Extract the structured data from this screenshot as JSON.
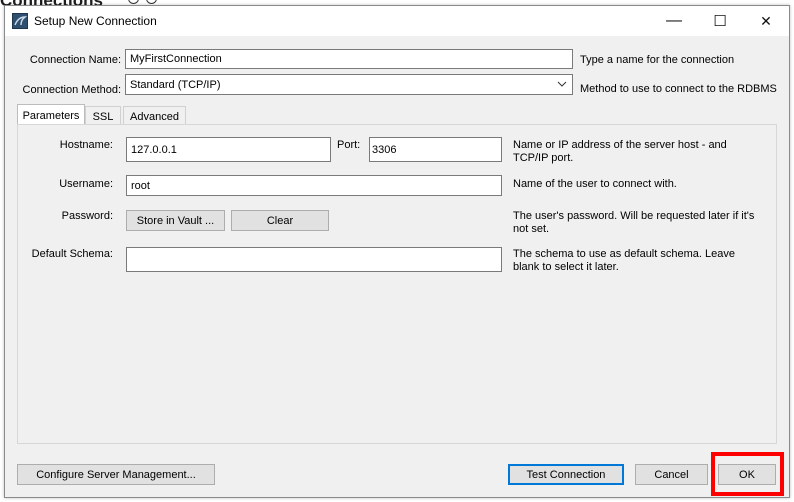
{
  "background": {
    "heading": "Connections"
  },
  "window": {
    "title": "Setup New Connection"
  },
  "controls": {
    "minimize": "—",
    "maximize": "☐",
    "close": "✕"
  },
  "form": {
    "connection_name": {
      "label": "Connection Name:",
      "value": "MyFirstConnection",
      "hint": "Type a name for the connection"
    },
    "connection_method": {
      "label": "Connection Method:",
      "value": "Standard (TCP/IP)",
      "hint": "Method to use to connect to the RDBMS"
    }
  },
  "tabs": [
    {
      "label": "Parameters",
      "active": true
    },
    {
      "label": "SSL",
      "active": false
    },
    {
      "label": "Advanced",
      "active": false
    }
  ],
  "parameters": {
    "hostname": {
      "label": "Hostname:",
      "value": "127.0.0.1"
    },
    "port": {
      "label": "Port:",
      "value": "3306",
      "hint": "Name or IP address of the server host - and TCP/IP port."
    },
    "username": {
      "label": "Username:",
      "value": "root",
      "hint": "Name of the user to connect with."
    },
    "password": {
      "label": "Password:",
      "store_button": "Store in Vault ...",
      "clear_button": "Clear",
      "hint": "The user's password. Will be requested later if it's not set."
    },
    "default_schema": {
      "label": "Default Schema:",
      "value": "",
      "hint": "The schema to use as default schema. Leave blank to select it later."
    }
  },
  "footer": {
    "configure": "Configure Server Management...",
    "test": "Test Connection",
    "cancel": "Cancel",
    "ok": "OK"
  },
  "colors": {
    "highlight": "#ff0000",
    "focus": "#0078d7"
  }
}
